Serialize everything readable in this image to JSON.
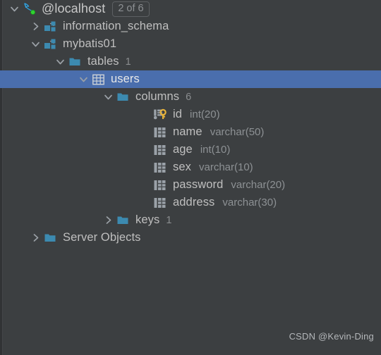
{
  "panel": {
    "name": "database-tree-panel",
    "background_color": "#3c3f41",
    "selection_color": "#4a6ead",
    "text_color": "#bfbfbf",
    "muted_text_color": "#8a8d8f",
    "folder_color": "#3c8ab0",
    "key_color": "#e8b33a",
    "connected_dot_color": "#2fd331"
  },
  "watermark": "CSDN @Kevin-Ding",
  "nodes": [
    {
      "label": "@localhost",
      "icon": "mysql-dolphin-icon",
      "twisty": "chevron-down-icon",
      "indent": 10,
      "badge": "2 of 6",
      "meta": "",
      "type": "",
      "selected": false,
      "name": "tree-node-localhost"
    },
    {
      "label": "information_schema",
      "icon": "schema-icon",
      "twisty": "chevron-right-icon",
      "indent": 40,
      "badge": "",
      "meta": "",
      "type": "",
      "selected": false,
      "name": "tree-node-information-schema"
    },
    {
      "label": "mybatis01",
      "icon": "schema-icon",
      "twisty": "chevron-down-icon",
      "indent": 40,
      "badge": "",
      "meta": "",
      "type": "",
      "selected": false,
      "name": "tree-node-mybatis01"
    },
    {
      "label": "tables",
      "icon": "folder-icon",
      "twisty": "chevron-down-icon",
      "indent": 75,
      "badge": "",
      "meta": "1",
      "type": "",
      "selected": false,
      "name": "tree-node-tables"
    },
    {
      "label": "users",
      "icon": "table-icon",
      "twisty": "chevron-down-icon",
      "indent": 108,
      "badge": "",
      "meta": "",
      "type": "",
      "selected": true,
      "name": "tree-node-users"
    },
    {
      "label": "columns",
      "icon": "folder-icon",
      "twisty": "chevron-down-icon",
      "indent": 143,
      "badge": "",
      "meta": "6",
      "type": "",
      "selected": false,
      "name": "tree-node-columns"
    },
    {
      "label": "id",
      "icon": "primary-key-column-icon",
      "twisty": "none",
      "indent": 196,
      "badge": "",
      "meta": "",
      "type": "int(20)",
      "selected": false,
      "name": "tree-node-column-id"
    },
    {
      "label": "name",
      "icon": "column-icon",
      "twisty": "none",
      "indent": 196,
      "badge": "",
      "meta": "",
      "type": "varchar(50)",
      "selected": false,
      "name": "tree-node-column-name"
    },
    {
      "label": "age",
      "icon": "column-icon",
      "twisty": "none",
      "indent": 196,
      "badge": "",
      "meta": "",
      "type": "int(10)",
      "selected": false,
      "name": "tree-node-column-age"
    },
    {
      "label": "sex",
      "icon": "column-icon",
      "twisty": "none",
      "indent": 196,
      "badge": "",
      "meta": "",
      "type": "varchar(10)",
      "selected": false,
      "name": "tree-node-column-sex"
    },
    {
      "label": "password",
      "icon": "column-icon",
      "twisty": "none",
      "indent": 196,
      "badge": "",
      "meta": "",
      "type": "varchar(20)",
      "selected": false,
      "name": "tree-node-column-password"
    },
    {
      "label": "address",
      "icon": "column-icon",
      "twisty": "none",
      "indent": 196,
      "badge": "",
      "meta": "",
      "type": "varchar(30)",
      "selected": false,
      "name": "tree-node-column-address"
    },
    {
      "label": "keys",
      "icon": "folder-icon",
      "twisty": "chevron-right-icon",
      "indent": 143,
      "badge": "",
      "meta": "1",
      "type": "",
      "selected": false,
      "name": "tree-node-keys"
    },
    {
      "label": "Server Objects",
      "icon": "folder-icon",
      "twisty": "chevron-right-icon",
      "indent": 40,
      "badge": "",
      "meta": "",
      "type": "",
      "selected": false,
      "name": "tree-node-server-objects"
    }
  ]
}
